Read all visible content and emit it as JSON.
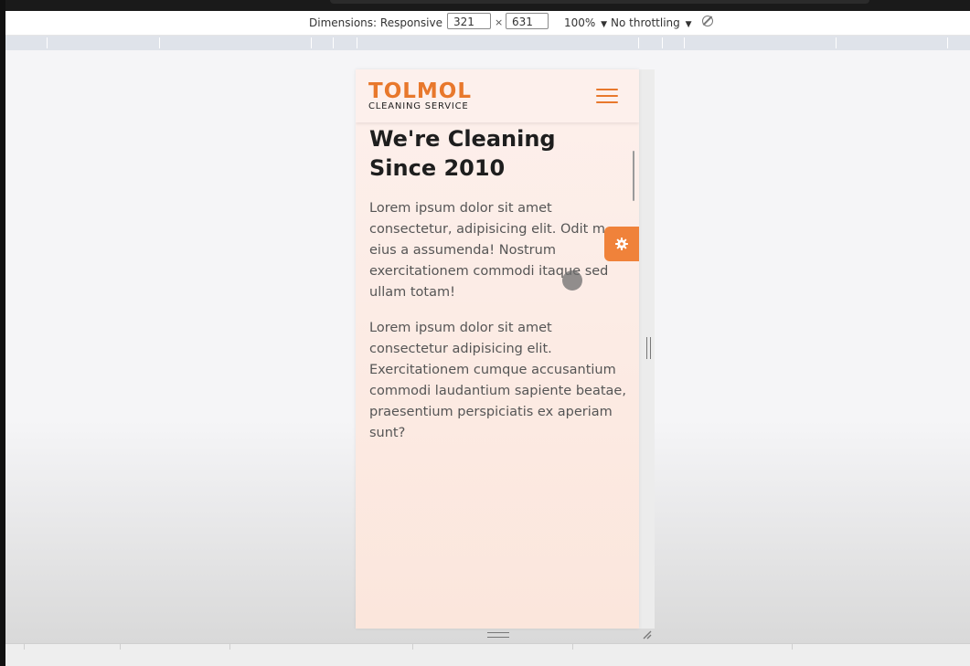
{
  "devtools": {
    "dimensions_label": "Dimensions: Responsive",
    "dropdown_arrow": "▼",
    "width_value": "321",
    "times": "×",
    "height_value": "631",
    "zoom_label": "100%",
    "throttling_label": "No throttling",
    "rotate_icon": "rotate-icon"
  },
  "site": {
    "logo_title": "TOLMOL",
    "logo_subtitle": "CLEANING SERVICE",
    "menu_icon": "hamburger-menu-icon",
    "heading": "We're Cleaning Since 2010",
    "paragraph_1": "Lorem ipsum dolor sit amet consectetur, adipisicing elit. Odit m eius a assumenda! Nostrum exercitationem commodi itaque sed ullam totam!",
    "paragraph_2": "Lorem ipsum dolor sit amet consectetur adipisicing elit. Exercitationem cumque accusantium commodi laudantium sapiente beatae, praesentium perspiciatis ex aperiam sunt?",
    "settings_icon": "gear-icon"
  },
  "colors": {
    "accent": "#e8782c",
    "settings_bg": "#f0823a",
    "page_bg": "#fdf0ec",
    "heading_text": "#1e1e1e",
    "body_text": "#555555"
  }
}
